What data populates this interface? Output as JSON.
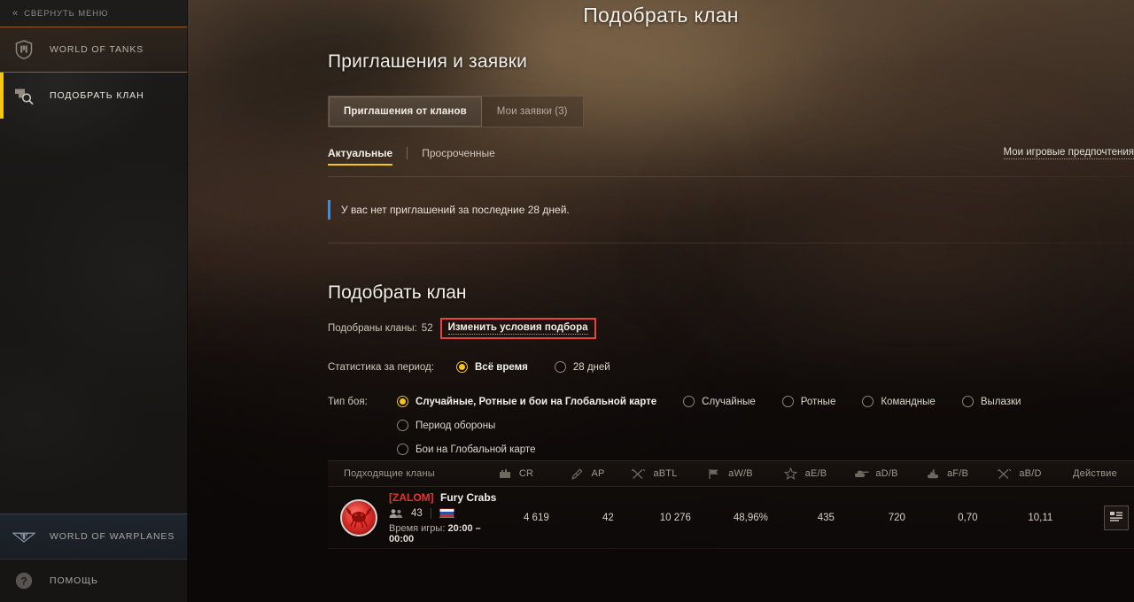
{
  "sidebar": {
    "collapse": {
      "label": "СВЕРНУТЬ МЕНЮ",
      "icon": "chevron-left-double-icon",
      "chevrons": "«"
    },
    "items": [
      {
        "id": "world-of-tanks",
        "label": "WORLD OF TANKS",
        "icon": "wot-shield-icon",
        "state": "highlighted"
      },
      {
        "id": "find-clan",
        "label": "ПОДОБРАТЬ КЛАН",
        "icon": "clan-search-icon",
        "state": "active"
      }
    ],
    "bottom_items": [
      {
        "id": "world-of-warplanes",
        "label": "WORLD OF WARPLANES",
        "icon": "wowp-wings-icon"
      },
      {
        "id": "help",
        "label": "ПОМОЩЬ",
        "icon": "question-mark-icon"
      }
    ],
    "accent_active": "#f5c518",
    "accent_highlight": "#9a5a24"
  },
  "header": {
    "title": "Подобрать клан"
  },
  "invitations": {
    "heading": "Приглашения и заявки",
    "segmented": [
      {
        "label": "Приглашения от кланов",
        "active": true
      },
      {
        "label": "Мои заявки (3)",
        "active": false
      }
    ],
    "subtabs": [
      {
        "label": "Актуальные",
        "active": true
      },
      {
        "label": "Просроченные",
        "active": false
      }
    ],
    "prefs_link": "Мои игровые предпочтения",
    "notice": "У вас нет приглашений за последние 28 дней.",
    "notice_color": "#3e8fd8"
  },
  "find_clan": {
    "heading": "Подобрать клан",
    "found_label": "Подобраны кланы:",
    "found_count": "52",
    "change_link": "Изменить условия подбора",
    "highlight_color": "#e8433f",
    "stats_period": {
      "label": "Статистика за период:",
      "options": [
        {
          "label": "Всё время",
          "selected": true
        },
        {
          "label": "28 дней",
          "selected": false
        }
      ]
    },
    "battle_type": {
      "label": "Тип боя:",
      "options": [
        {
          "label": "Случайные, Ротные и бои на Глобальной карте",
          "selected": true
        },
        {
          "label": "Случайные",
          "selected": false
        },
        {
          "label": "Ротные",
          "selected": false
        },
        {
          "label": "Командные",
          "selected": false
        },
        {
          "label": "Вылазки",
          "selected": false
        },
        {
          "label": "Период обороны",
          "selected": false
        },
        {
          "label": "Бои на Глобальной карте",
          "selected": false,
          "new_row": true
        }
      ]
    }
  },
  "table": {
    "columns": [
      {
        "key": "name",
        "label": "Подходящие кланы",
        "icon": null
      },
      {
        "key": "cr",
        "label": "CR",
        "icon": "fortress-icon"
      },
      {
        "key": "ap",
        "label": "AP",
        "icon": "pen-icon"
      },
      {
        "key": "abtl",
        "label": "aBTL",
        "icon": "swords-icon"
      },
      {
        "key": "awb",
        "label": "aW/B",
        "icon": "flag-icon"
      },
      {
        "key": "aeb",
        "label": "aE/B",
        "icon": "star-icon"
      },
      {
        "key": "adb",
        "label": "aD/B",
        "icon": "tank-icon"
      },
      {
        "key": "afb",
        "label": "aF/B",
        "icon": "burning-tank-icon"
      },
      {
        "key": "abd",
        "label": "aB/D",
        "icon": "swords-icon"
      },
      {
        "key": "action",
        "label": "Действие",
        "icon": null
      }
    ],
    "rows": [
      {
        "emblem": "red-crab-emblem",
        "tag": "[ZALOM]",
        "name": "Fury Crabs",
        "members_icon": "people-icon",
        "members": "43",
        "flag": "ru-flag",
        "time_label": "Время игры:",
        "time_value": "20:00 – 00:00",
        "cr": "4 619",
        "ap": "42",
        "abtl": "10 276",
        "awb": "48,96%",
        "aeb": "435",
        "adb": "720",
        "afb": "0,70",
        "abd": "10,11",
        "action_icon": "details-list-icon"
      }
    ]
  }
}
